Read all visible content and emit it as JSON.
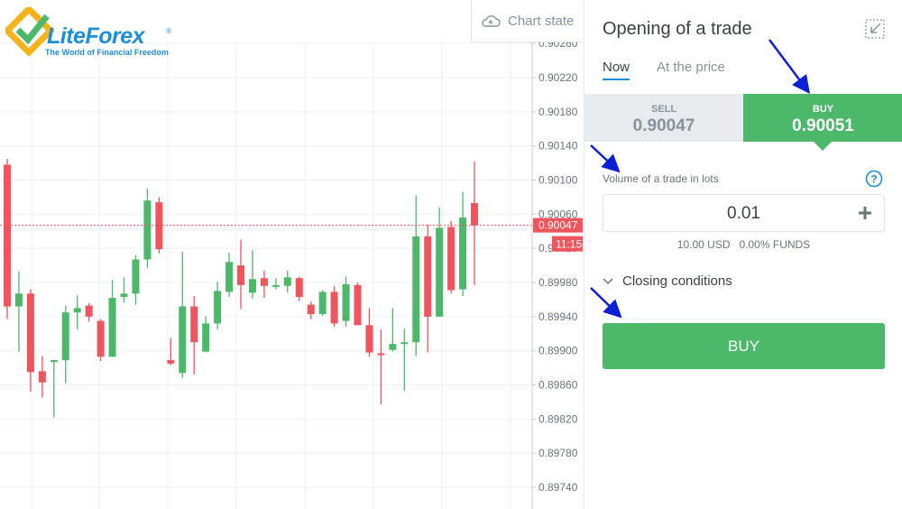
{
  "header": {
    "logo_name": "LiteForex",
    "logo_tagline": "The World of Financial Freedom",
    "chart_state_label": "Chart state",
    "icons": [
      "logo-icon",
      "cloud-icon"
    ]
  },
  "chart": {
    "current_price": "0.90047",
    "time_label": "11:15",
    "y_ticks": [
      "0.90260",
      "0.90220",
      "0.90180",
      "0.90140",
      "0.90100",
      "0.90060",
      "0.90020",
      "0.89980",
      "0.89940",
      "0.89900",
      "0.89860",
      "0.89820",
      "0.89780",
      "0.89740"
    ],
    "colors": {
      "up": "#4cb96a",
      "down": "#f0545c",
      "grid": "#eef0f2"
    }
  },
  "chart_data": {
    "type": "candlestick",
    "ylim": [
      0.8972,
      0.9027
    ],
    "candles": [
      {
        "o": 0.90118,
        "c": 0.89952,
        "h": 0.90125,
        "l": 0.89937
      },
      {
        "o": 0.89952,
        "c": 0.89967,
        "h": 0.89993,
        "l": 0.89899
      },
      {
        "o": 0.89967,
        "c": 0.89875,
        "h": 0.89972,
        "l": 0.89852
      },
      {
        "o": 0.89876,
        "c": 0.89863,
        "h": 0.89894,
        "l": 0.89845
      },
      {
        "o": 0.89889,
        "c": 0.89889,
        "h": 0.89889,
        "l": 0.89822
      },
      {
        "o": 0.89889,
        "c": 0.89945,
        "h": 0.89953,
        "l": 0.89862
      },
      {
        "o": 0.89945,
        "c": 0.8995,
        "h": 0.89965,
        "l": 0.89925
      },
      {
        "o": 0.89953,
        "c": 0.8994,
        "h": 0.89956,
        "l": 0.89934
      },
      {
        "o": 0.89935,
        "c": 0.89893,
        "h": 0.89937,
        "l": 0.89888
      },
      {
        "o": 0.89893,
        "c": 0.89962,
        "h": 0.89983,
        "l": 0.89893
      },
      {
        "o": 0.89963,
        "c": 0.89967,
        "h": 0.89986,
        "l": 0.89956
      },
      {
        "o": 0.89967,
        "c": 0.90007,
        "h": 0.90012,
        "l": 0.89954
      },
      {
        "o": 0.90007,
        "c": 0.90076,
        "h": 0.9009,
        "l": 0.89997
      },
      {
        "o": 0.90074,
        "c": 0.90019,
        "h": 0.9008,
        "l": 0.90014
      },
      {
        "o": 0.89889,
        "c": 0.89885,
        "h": 0.89915,
        "l": 0.89883
      },
      {
        "o": 0.89874,
        "c": 0.89952,
        "h": 0.90016,
        "l": 0.89868
      },
      {
        "o": 0.89952,
        "c": 0.8991,
        "h": 0.89964,
        "l": 0.89872
      },
      {
        "o": 0.89899,
        "c": 0.89932,
        "h": 0.8994,
        "l": 0.89898
      },
      {
        "o": 0.89932,
        "c": 0.8997,
        "h": 0.89981,
        "l": 0.89925
      },
      {
        "o": 0.89969,
        "c": 0.90004,
        "h": 0.90015,
        "l": 0.89963
      },
      {
        "o": 0.9,
        "c": 0.89977,
        "h": 0.9003,
        "l": 0.89949
      },
      {
        "o": 0.89968,
        "c": 0.89984,
        "h": 0.90018,
        "l": 0.89961
      },
      {
        "o": 0.89985,
        "c": 0.89976,
        "h": 0.89994,
        "l": 0.89962
      },
      {
        "o": 0.89977,
        "c": 0.89977,
        "h": 0.89985,
        "l": 0.89972
      },
      {
        "o": 0.89976,
        "c": 0.89986,
        "h": 0.89994,
        "l": 0.89968
      },
      {
        "o": 0.89985,
        "c": 0.89963,
        "h": 0.89987,
        "l": 0.89958
      },
      {
        "o": 0.89954,
        "c": 0.89943,
        "h": 0.89958,
        "l": 0.89937
      },
      {
        "o": 0.89943,
        "c": 0.89969,
        "h": 0.89971,
        "l": 0.89941
      },
      {
        "o": 0.89969,
        "c": 0.89932,
        "h": 0.89976,
        "l": 0.89928
      },
      {
        "o": 0.89935,
        "c": 0.89978,
        "h": 0.89987,
        "l": 0.89928
      },
      {
        "o": 0.89977,
        "c": 0.8993,
        "h": 0.8998,
        "l": 0.8993
      },
      {
        "o": 0.8993,
        "c": 0.89898,
        "h": 0.8995,
        "l": 0.89893
      },
      {
        "o": 0.89897,
        "c": 0.89895,
        "h": 0.89925,
        "l": 0.89837
      },
      {
        "o": 0.89901,
        "c": 0.89908,
        "h": 0.8995,
        "l": 0.89899
      },
      {
        "o": 0.89909,
        "c": 0.8991,
        "h": 0.89926,
        "l": 0.89853
      },
      {
        "o": 0.8991,
        "c": 0.90034,
        "h": 0.90082,
        "l": 0.89894
      },
      {
        "o": 0.90034,
        "c": 0.8994,
        "h": 0.90048,
        "l": 0.89898
      },
      {
        "o": 0.8994,
        "c": 0.90044,
        "h": 0.90068,
        "l": 0.8994
      },
      {
        "o": 0.90045,
        "c": 0.89971,
        "h": 0.90052,
        "l": 0.89967
      },
      {
        "o": 0.89972,
        "c": 0.90056,
        "h": 0.90086,
        "l": 0.89964
      },
      {
        "o": 0.90073,
        "c": 0.90047,
        "h": 0.90122,
        "l": 0.89977
      }
    ]
  },
  "panel": {
    "title": "Opening of a trade",
    "tabs": [
      "Now",
      "At the price"
    ],
    "sell_label": "SELL",
    "sell_price": "0.90047",
    "buy_label": "BUY",
    "buy_price": "0.90051",
    "volume_label": "Volume of a trade in lots",
    "volume_value": "0.01",
    "funds_line": "10.00 USD   0.00% FUNDS",
    "closing_conditions": "Closing conditions",
    "buy_button": "BUY",
    "icons": [
      "collapse-icon",
      "help-icon",
      "plus-icon",
      "chevron-down-icon"
    ],
    "accent": "#4cb96a"
  }
}
